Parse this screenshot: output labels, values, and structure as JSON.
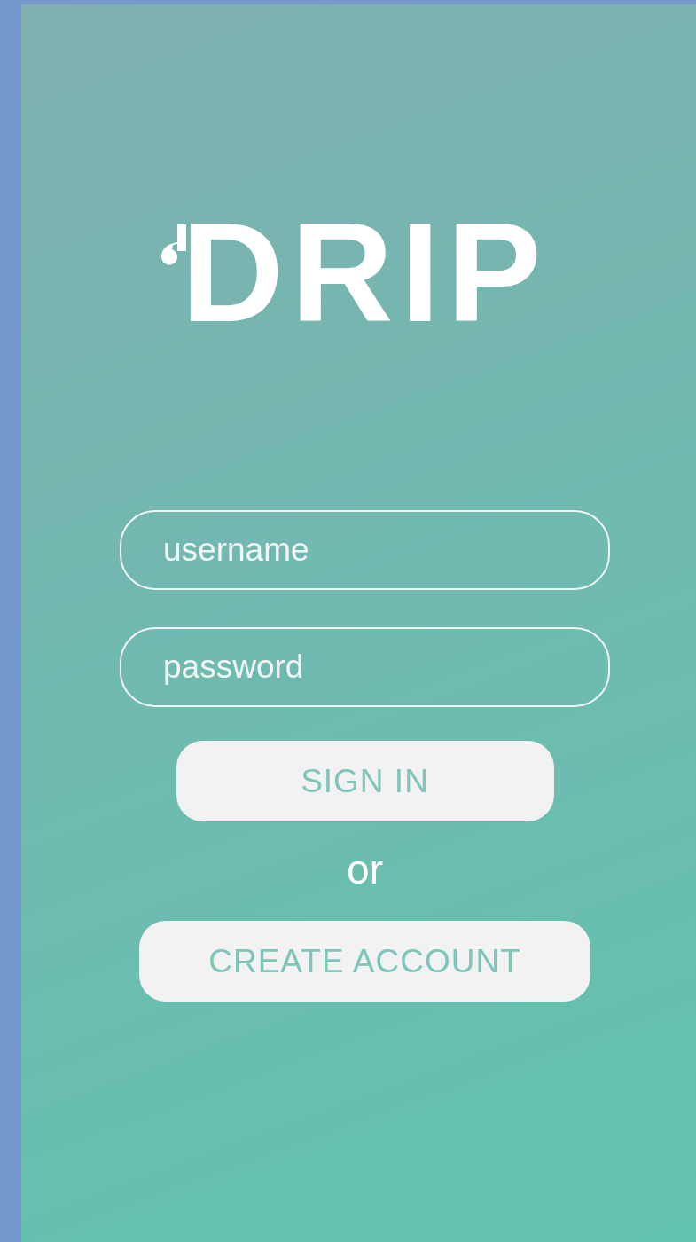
{
  "logo": {
    "text": "DRIP"
  },
  "fields": [
    {
      "placeholder": "username"
    },
    {
      "placeholder": "password"
    }
  ],
  "buttons": [
    {
      "label": "SIGN IN"
    },
    {
      "label": "CREATE ACCOUNT"
    }
  ],
  "separator": "or"
}
